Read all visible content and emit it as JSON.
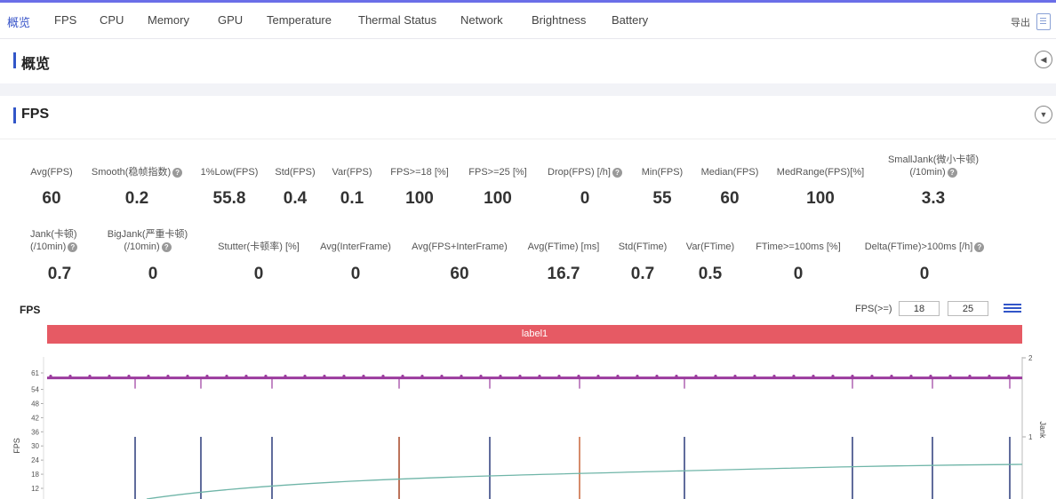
{
  "nav": {
    "tabs": [
      "概览",
      "FPS",
      "CPU",
      "Memory",
      "GPU",
      "Temperature",
      "Thermal Status",
      "Network",
      "Brightness",
      "Battery"
    ],
    "active": "概览",
    "export_label": "导出"
  },
  "overview_section": {
    "title": "概览",
    "toggle_icon": "chevron-left"
  },
  "fps_section": {
    "title": "FPS",
    "toggle_icon": "chevron-down"
  },
  "metrics_row1": [
    {
      "label": "Avg(FPS)",
      "value": "60"
    },
    {
      "label": "Smooth(稳帧指数)",
      "value": "0.2",
      "help": true
    },
    {
      "label": "1%Low(FPS)",
      "value": "55.8"
    },
    {
      "label": "Std(FPS)",
      "value": "0.4"
    },
    {
      "label": "Var(FPS)",
      "value": "0.1"
    },
    {
      "label": "FPS>=18 [%]",
      "value": "100"
    },
    {
      "label": "FPS>=25 [%]",
      "value": "100"
    },
    {
      "label": "Drop(FPS) [/h]",
      "value": "0",
      "help": true
    },
    {
      "label": "Min(FPS)",
      "value": "55"
    },
    {
      "label": "Median(FPS)",
      "value": "60"
    },
    {
      "label": "MedRange(FPS)[%]",
      "value": "100"
    },
    {
      "label": "SmallJank(微小卡顿)",
      "label2": "(/10min)",
      "value": "3.3",
      "help": true
    }
  ],
  "metrics_row2": [
    {
      "label": "Jank(卡顿)",
      "label2": "(/10min)",
      "value": "0.7",
      "help": true
    },
    {
      "label": "BigJank(严重卡顿)",
      "label2": "(/10min)",
      "value": "0",
      "help": true
    },
    {
      "label": "Stutter(卡顿率) [%]",
      "value": "0"
    },
    {
      "label": "Avg(InterFrame)",
      "value": "0"
    },
    {
      "label": "Avg(FPS+InterFrame)",
      "value": "60"
    },
    {
      "label": "Avg(FTime) [ms]",
      "value": "16.7"
    },
    {
      "label": "Std(FTime)",
      "value": "0.7"
    },
    {
      "label": "Var(FTime)",
      "value": "0.5"
    },
    {
      "label": "FTime>=100ms [%]",
      "value": "0"
    },
    {
      "label": "Delta(FTime)>100ms [/h]",
      "value": "0",
      "help": true
    }
  ],
  "chart_panel": {
    "title": "FPS",
    "threshold_label": "FPS(>=)",
    "threshold_low": "18",
    "threshold_high": "25",
    "band_label": "label1",
    "y_axis_label": "FPS",
    "y2_axis_label": "Jank",
    "colors": {
      "fps_line": "#9b3b9e",
      "jank_bar": "#2b3a7a",
      "bigjank_bar": "#c8653a",
      "smooth_line": "#6fb5a8",
      "band": "#e65a64"
    }
  },
  "chart_data": {
    "type": "line",
    "y_ticks": [
      61,
      54,
      48,
      42,
      36,
      30,
      24,
      18,
      12
    ],
    "y2_ticks": [
      2,
      1
    ],
    "fps_level": 60,
    "jank_markers": [
      1,
      1,
      1,
      1,
      1,
      1,
      1,
      1,
      1,
      1
    ],
    "bigjank_markers": [
      1,
      1
    ]
  }
}
